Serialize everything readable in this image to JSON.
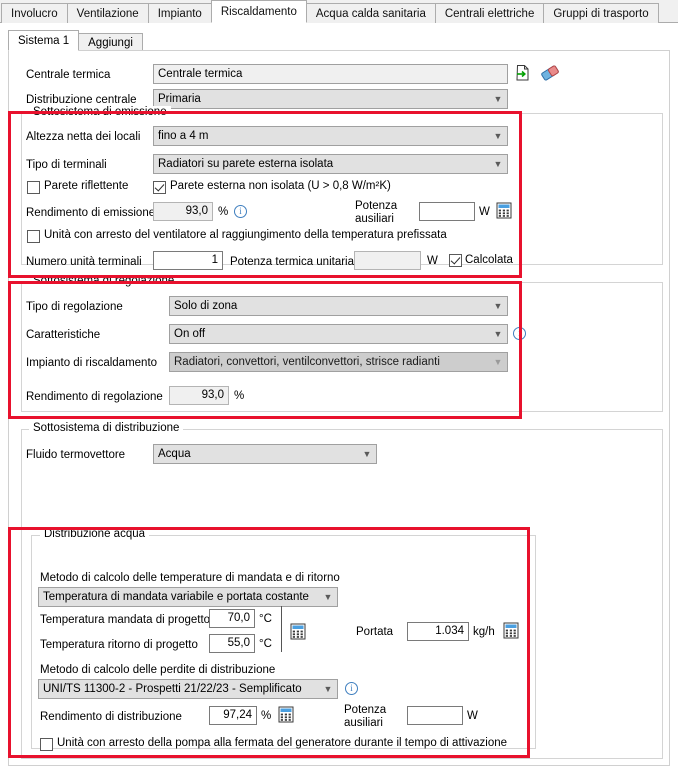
{
  "window": {
    "title": "Riscaldamento"
  },
  "top_tabs": [
    {
      "label": "Involucro",
      "active": false
    },
    {
      "label": "Ventilazione",
      "active": false
    },
    {
      "label": "Impianto",
      "active": false
    },
    {
      "label": "Riscaldamento",
      "active": true
    },
    {
      "label": "Acqua calda sanitaria",
      "active": false
    },
    {
      "label": "Centrali elettriche",
      "active": false
    },
    {
      "label": "Gruppi di trasporto",
      "active": false
    }
  ],
  "sub_tabs": [
    {
      "label": "Sistema 1",
      "active": true
    },
    {
      "label": "Aggiungi",
      "active": false
    }
  ],
  "header": {
    "centrale_termica_label": "Centrale termica",
    "centrale_termica_value": "Centrale termica",
    "distribuzione_centrale_label": "Distribuzione centrale",
    "distribuzione_centrale_value": "Primaria",
    "icon_export": "export-document-icon",
    "icon_eraser": "eraser-icon"
  },
  "emissione": {
    "caption": "Sottosistema di emissione",
    "altezza_label": "Altezza netta dei locali",
    "altezza_value": "fino a 4 m",
    "terminali_label": "Tipo di terminali",
    "terminali_value": "Radiatori su parete esterna isolata",
    "parete_riflettente_label": "Parete riflettente",
    "parete_riflettente_checked": false,
    "parete_esterna_label": "Parete esterna non isolata (U > 0,8 W/m²K)",
    "parete_esterna_checked": true,
    "rendimento_label": "Rendimento di emissione",
    "rendimento_value": "93,0",
    "rendimento_unit": "%",
    "potenza_aux_label_1": "Potenza",
    "potenza_aux_label_2": "ausiliari",
    "potenza_aux_value": "",
    "potenza_aux_unit": "W",
    "unita_arresto_label": "Unità con arresto del ventilatore al raggiungimento della temperatura prefissata",
    "unita_arresto_checked": false,
    "numero_unita_label": "Numero unità terminali",
    "numero_unita_value": "1",
    "potenza_termica_label": "Potenza termica unitaria",
    "potenza_termica_value": "",
    "potenza_termica_unit": "W",
    "calcolata_label": "Calcolata",
    "calcolata_checked": true,
    "icon_calc": "calculator-icon",
    "icon_info": "info-icon"
  },
  "regolazione": {
    "caption": "Sottosistema di regolazione",
    "tipo_label": "Tipo di regolazione",
    "tipo_value": "Solo di zona",
    "caratteristiche_label": "Caratteristiche",
    "caratteristiche_value": "On off",
    "impianto_label": "Impianto di riscaldamento",
    "impianto_value": "Radiatori, convettori, ventilconvettori, strisce radianti",
    "rendimento_label": "Rendimento di regolazione",
    "rendimento_value": "93,0",
    "rendimento_unit": "%",
    "icon_info": "info-icon"
  },
  "distribuzione": {
    "caption": "Sottosistema di distribuzione",
    "fluido_label": "Fluido termovettore",
    "fluido_value": "Acqua"
  },
  "distribuzione_acqua": {
    "caption": "Distribuzione acqua",
    "metodo_temp_label": "Metodo di calcolo delle temperature di mandata e di ritorno",
    "metodo_temp_value": "Temperatura di mandata variabile e portata costante",
    "temp_mandata_label": "Temperatura mandata di progetto",
    "temp_mandata_value": "70,0",
    "temp_mandata_unit": "°C",
    "temp_ritorno_label": "Temperatura ritorno di progetto",
    "temp_ritorno_value": "55,0",
    "temp_ritorno_unit": "°C",
    "portata_label": "Portata",
    "portata_value": "1.034",
    "portata_unit": "kg/h",
    "metodo_perdite_label": "Metodo di calcolo delle perdite di distribuzione",
    "metodo_perdite_value": "UNI/TS 11300-2 - Prospetti 21/22/23 - Semplificato",
    "rendimento_label": "Rendimento di distribuzione",
    "rendimento_value": "97,24",
    "rendimento_unit": "%",
    "potenza_aux_label_1": "Potenza",
    "potenza_aux_label_2": "ausiliari",
    "potenza_aux_value": "",
    "potenza_aux_unit": "W",
    "unita_arresto_label": "Unità con arresto della pompa alla fermata del generatore durante il tempo di attivazione",
    "unita_arresto_checked": false,
    "icon_calc": "calculator-icon",
    "icon_info": "info-icon"
  },
  "colors": {
    "highlight": "#e8112d",
    "accent_blue": "#3f7fbf",
    "panel_bg": "#ffffff",
    "field_disabled": "#e1e1e1"
  }
}
